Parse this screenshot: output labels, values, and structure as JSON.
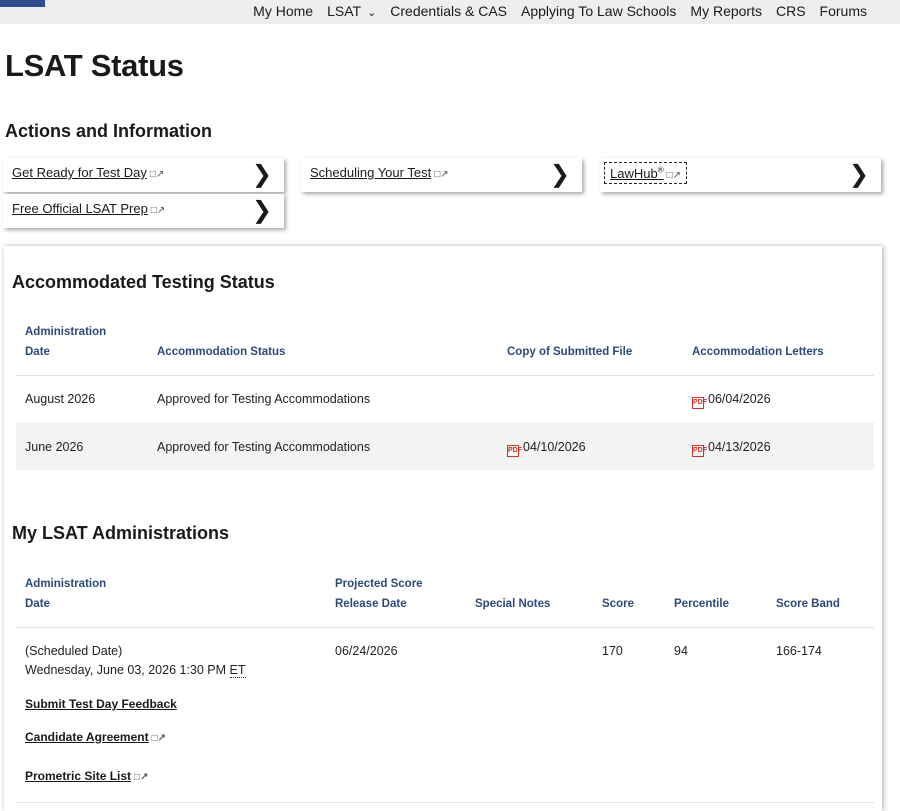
{
  "nav": {
    "items": [
      "My Home",
      "LSAT",
      "Credentials & CAS",
      "Applying To Law Schools",
      "My Reports",
      "CRS",
      "Forums"
    ]
  },
  "page_title": "LSAT Status",
  "actions": {
    "title": "Actions and Information",
    "cards": [
      {
        "label": "Get Ready for Test Day"
      },
      {
        "label": "Scheduling Your Test"
      },
      {
        "label": "LawHub",
        "sup": "®"
      },
      {
        "label": "Free Official LSAT Prep"
      }
    ]
  },
  "accommodated": {
    "title": "Accommodated Testing Status",
    "headers": {
      "admin_line1": "Administration",
      "admin_line2": "Date",
      "status": "Accommodation Status",
      "copy": "Copy of Submitted File",
      "letters": "Accommodation Letters"
    },
    "rows": [
      {
        "date": "August 2026",
        "status": "Approved for Testing Accommodations",
        "copy": "",
        "letters": "06/04/2026"
      },
      {
        "date": "June 2026",
        "status": "Approved for Testing Accommodations",
        "copy": "04/10/2026",
        "letters": "04/13/2026"
      }
    ]
  },
  "administrations": {
    "title": "My LSAT Administrations",
    "headers": {
      "admin_line1": "Administration",
      "admin_line2": "Date",
      "release_line1": "Projected Score",
      "release_line2": "Release Date",
      "notes": "Special Notes",
      "score": "Score",
      "percentile": "Percentile",
      "band": "Score Band"
    },
    "row": {
      "date_label": "(Scheduled Date)",
      "date_value": "Wednesday, June 03, 2026 1:30 PM",
      "tz": "ET",
      "release": "06/24/2026",
      "score": "170",
      "percentile": "94",
      "band": "166-174"
    },
    "links": [
      "Submit Test Day Feedback",
      "Candidate Agreement",
      "Prometric Site List"
    ]
  },
  "colors": {
    "header_blue": "#2b4a7a",
    "pdf_red": "#c0392b"
  }
}
